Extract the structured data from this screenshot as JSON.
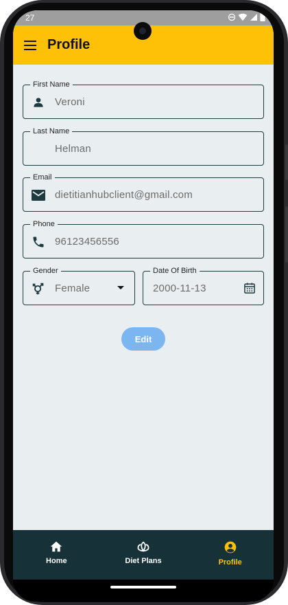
{
  "status_bar": {
    "time": "27"
  },
  "app_bar": {
    "title": "Profile"
  },
  "fields": {
    "first_name": {
      "label": "First Name",
      "value": "Veroni"
    },
    "last_name": {
      "label": "Last Name",
      "value": "Helman"
    },
    "email": {
      "label": "Email",
      "value": "dietitianhubclient@gmail.com"
    },
    "phone": {
      "label": "Phone",
      "value": "96123456556"
    },
    "gender": {
      "label": "Gender",
      "value": "Female"
    },
    "dob": {
      "label": "Date Of Birth",
      "value": "2000-11-13"
    }
  },
  "edit_button": {
    "label": "Edit"
  },
  "bottom_nav": {
    "items": [
      {
        "label": "Home",
        "icon": "home-icon",
        "active": false
      },
      {
        "label": "Diet Plans",
        "icon": "lotus-icon",
        "active": false
      },
      {
        "label": "Profile",
        "icon": "account-circle-icon",
        "active": true
      }
    ]
  },
  "colors": {
    "app_bar": "#ffc107",
    "background": "#e9eef1",
    "bottom_nav": "#163137",
    "active_nav": "#ffc107",
    "edit_button": "#7bb6f1",
    "field_border": "#1d3a3f"
  }
}
